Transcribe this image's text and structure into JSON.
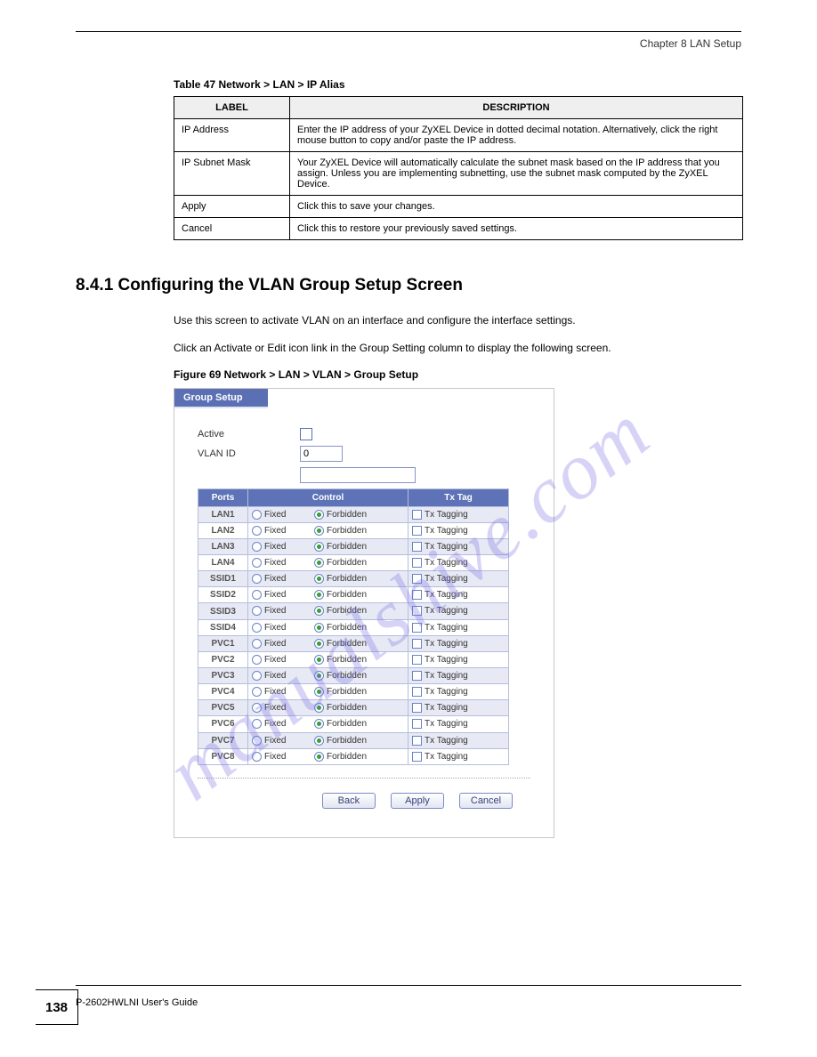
{
  "header": {
    "chapter_title": "Chapter 8 LAN Setup"
  },
  "table_a": {
    "caption": "Table 47   Network > LAN > IP Alias",
    "col1": "LABEL",
    "col2": "DESCRIPTION",
    "rows": [
      {
        "label": "IP Address",
        "desc": "Enter the IP address of your ZyXEL Device in dotted decimal notation. Alternatively, click the right mouse button to copy and/or paste the IP address."
      },
      {
        "label": "IP Subnet Mask",
        "desc": "Your ZyXEL Device will automatically calculate the subnet mask based on the IP address that you assign. Unless you are implementing subnetting, use the subnet mask computed by the ZyXEL Device."
      },
      {
        "label": "Apply",
        "desc": "Click this to save your changes."
      },
      {
        "label": "Cancel",
        "desc": "Click this to restore your previously saved settings."
      }
    ]
  },
  "section": {
    "heading": "8.4.1  Configuring the VLAN Group Setup Screen",
    "body1": "Use this screen to activate VLAN on an interface and configure the interface settings.",
    "body2": "Click an Activate or Edit icon link in the Group Setting column to display the following screen."
  },
  "figure_caption": "Figure 69   Network > LAN > VLAN > Group Setup",
  "group_setup": {
    "tab": "Group Setup",
    "active_label": "Active",
    "vlan_id_label": "VLAN ID",
    "vlan_id_value": "0",
    "headers": {
      "ports": "Ports",
      "control": "Control",
      "txtag": "Tx Tag"
    },
    "option_labels": {
      "fixed": "Fixed",
      "forbidden": "Forbidden",
      "txtagging": "Tx Tagging"
    },
    "ports": [
      "LAN1",
      "LAN2",
      "LAN3",
      "LAN4",
      "SSID1",
      "SSID2",
      "SSID3",
      "SSID4",
      "PVC1",
      "PVC2",
      "PVC3",
      "PVC4",
      "PVC5",
      "PVC6",
      "PVC7",
      "PVC8"
    ],
    "buttons": {
      "back": "Back",
      "apply": "Apply",
      "cancel": "Cancel"
    }
  },
  "footer": {
    "guide": "P-2602HWLNI User's Guide",
    "page": "138"
  },
  "watermark": "manualshive.com"
}
